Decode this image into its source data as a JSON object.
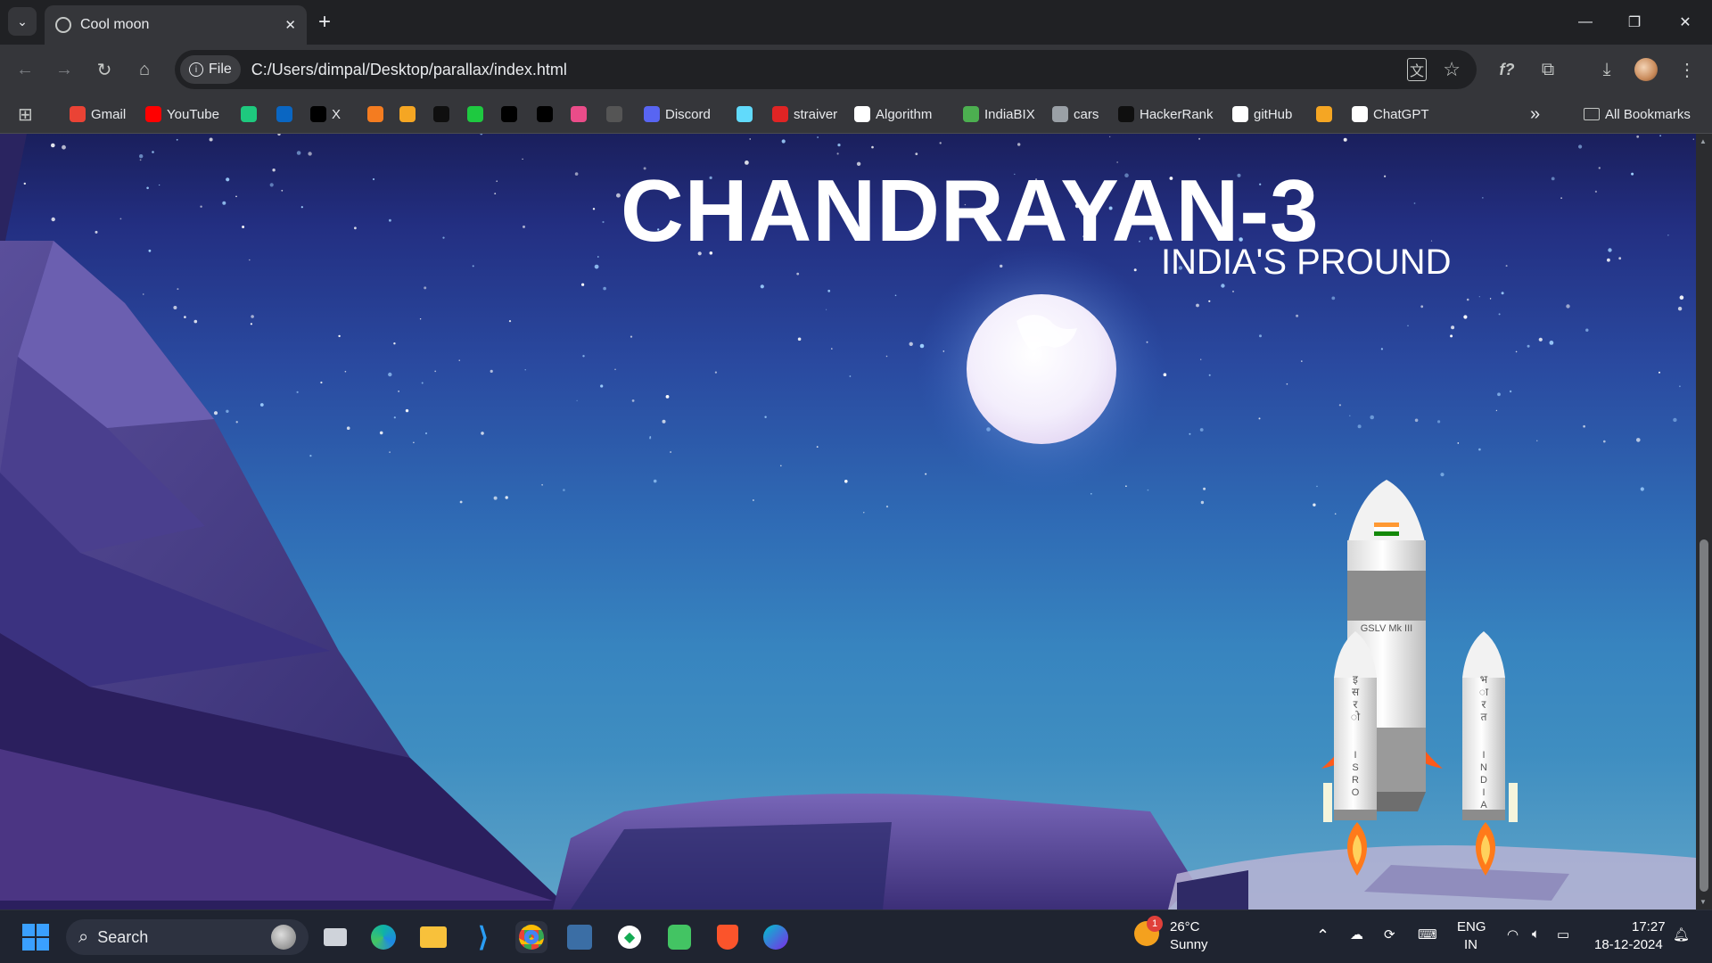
{
  "browser": {
    "tab_title": "Cool moon",
    "new_tab": "+",
    "window_controls": {
      "minimize": "—",
      "restore": "❐",
      "close": "✕"
    },
    "address_chip": "File",
    "url": "C:/Users/dimpal/Desktop/parallax/index.html",
    "toolbar_icons": [
      "translate-icon",
      "star-icon",
      "font-icon",
      "extensions-icon",
      "download-icon",
      "profile-avatar",
      "menu-icon"
    ]
  },
  "bookmarks": {
    "items": [
      {
        "label": "Gmail",
        "icon": "gmail-icon",
        "color": "#ea4335"
      },
      {
        "label": "YouTube",
        "icon": "youtube-icon",
        "color": "#ff0000"
      },
      {
        "label": "",
        "icon": "w-icon",
        "color": "#1ec97e"
      },
      {
        "label": "",
        "icon": "linkedin-icon",
        "color": "#0a66c2"
      },
      {
        "label": "X",
        "icon": "x-icon",
        "color": "#000000"
      },
      {
        "label": "",
        "icon": "orange-blocks-icon",
        "color": "#f47c20"
      },
      {
        "label": "",
        "icon": "layers-icon",
        "color": "#f5a623"
      },
      {
        "label": "",
        "icon": "hn-icon",
        "color": "#0f0f0f"
      },
      {
        "label": "",
        "icon": "g-icon",
        "color": "#1ec940"
      },
      {
        "label": "",
        "icon": "medium-icon",
        "color": "#000000"
      },
      {
        "label": "",
        "icon": "c-icon",
        "color": "#000000"
      },
      {
        "label": "",
        "icon": "dribbble-icon",
        "color": "#ea4c89"
      },
      {
        "label": "",
        "icon": "grid-icon",
        "color": "#555555"
      },
      {
        "label": "Discord",
        "icon": "discord-icon",
        "color": "#5865f2"
      },
      {
        "label": "",
        "icon": "react-icon",
        "color": "#61dafb"
      },
      {
        "label": "straiver",
        "icon": "tuf-icon",
        "color": "#e02424"
      },
      {
        "label": "Algorithm",
        "icon": "github-icon",
        "color": "#ffffff"
      },
      {
        "label": "IndiaBIX",
        "icon": "indiabix-icon",
        "color": "#4caf50"
      },
      {
        "label": "cars",
        "icon": "doc-icon",
        "color": "#9aa0a6"
      },
      {
        "label": "HackerRank",
        "icon": "hackerrank-icon",
        "color": "#0f0f0f"
      },
      {
        "label": "gitHub",
        "icon": "github-icon",
        "color": "#ffffff"
      },
      {
        "label": "",
        "icon": "layers-icon",
        "color": "#f5a623"
      },
      {
        "label": "ChatGPT",
        "icon": "chatgpt-icon",
        "color": "#ffffff"
      }
    ],
    "overflow": "»",
    "all_bookmarks": "All Bookmarks"
  },
  "page": {
    "title": "CHANDRAYAN-3",
    "subtitle": "INDIA'S PROUND",
    "rocket": {
      "core_label": "GSLV Mk III",
      "left_booster_hindi": "इसरो",
      "left_booster_text": "ISRO",
      "right_booster_hindi": "भारत",
      "right_booster_text": "INDIA"
    }
  },
  "taskbar": {
    "search_placeholder": "Search",
    "weather": {
      "temp": "26°C",
      "condition": "Sunny",
      "badge": "1"
    },
    "language": {
      "line1": "ENG",
      "line2": "IN"
    },
    "time": "17:27",
    "date": "18-12-2024"
  }
}
